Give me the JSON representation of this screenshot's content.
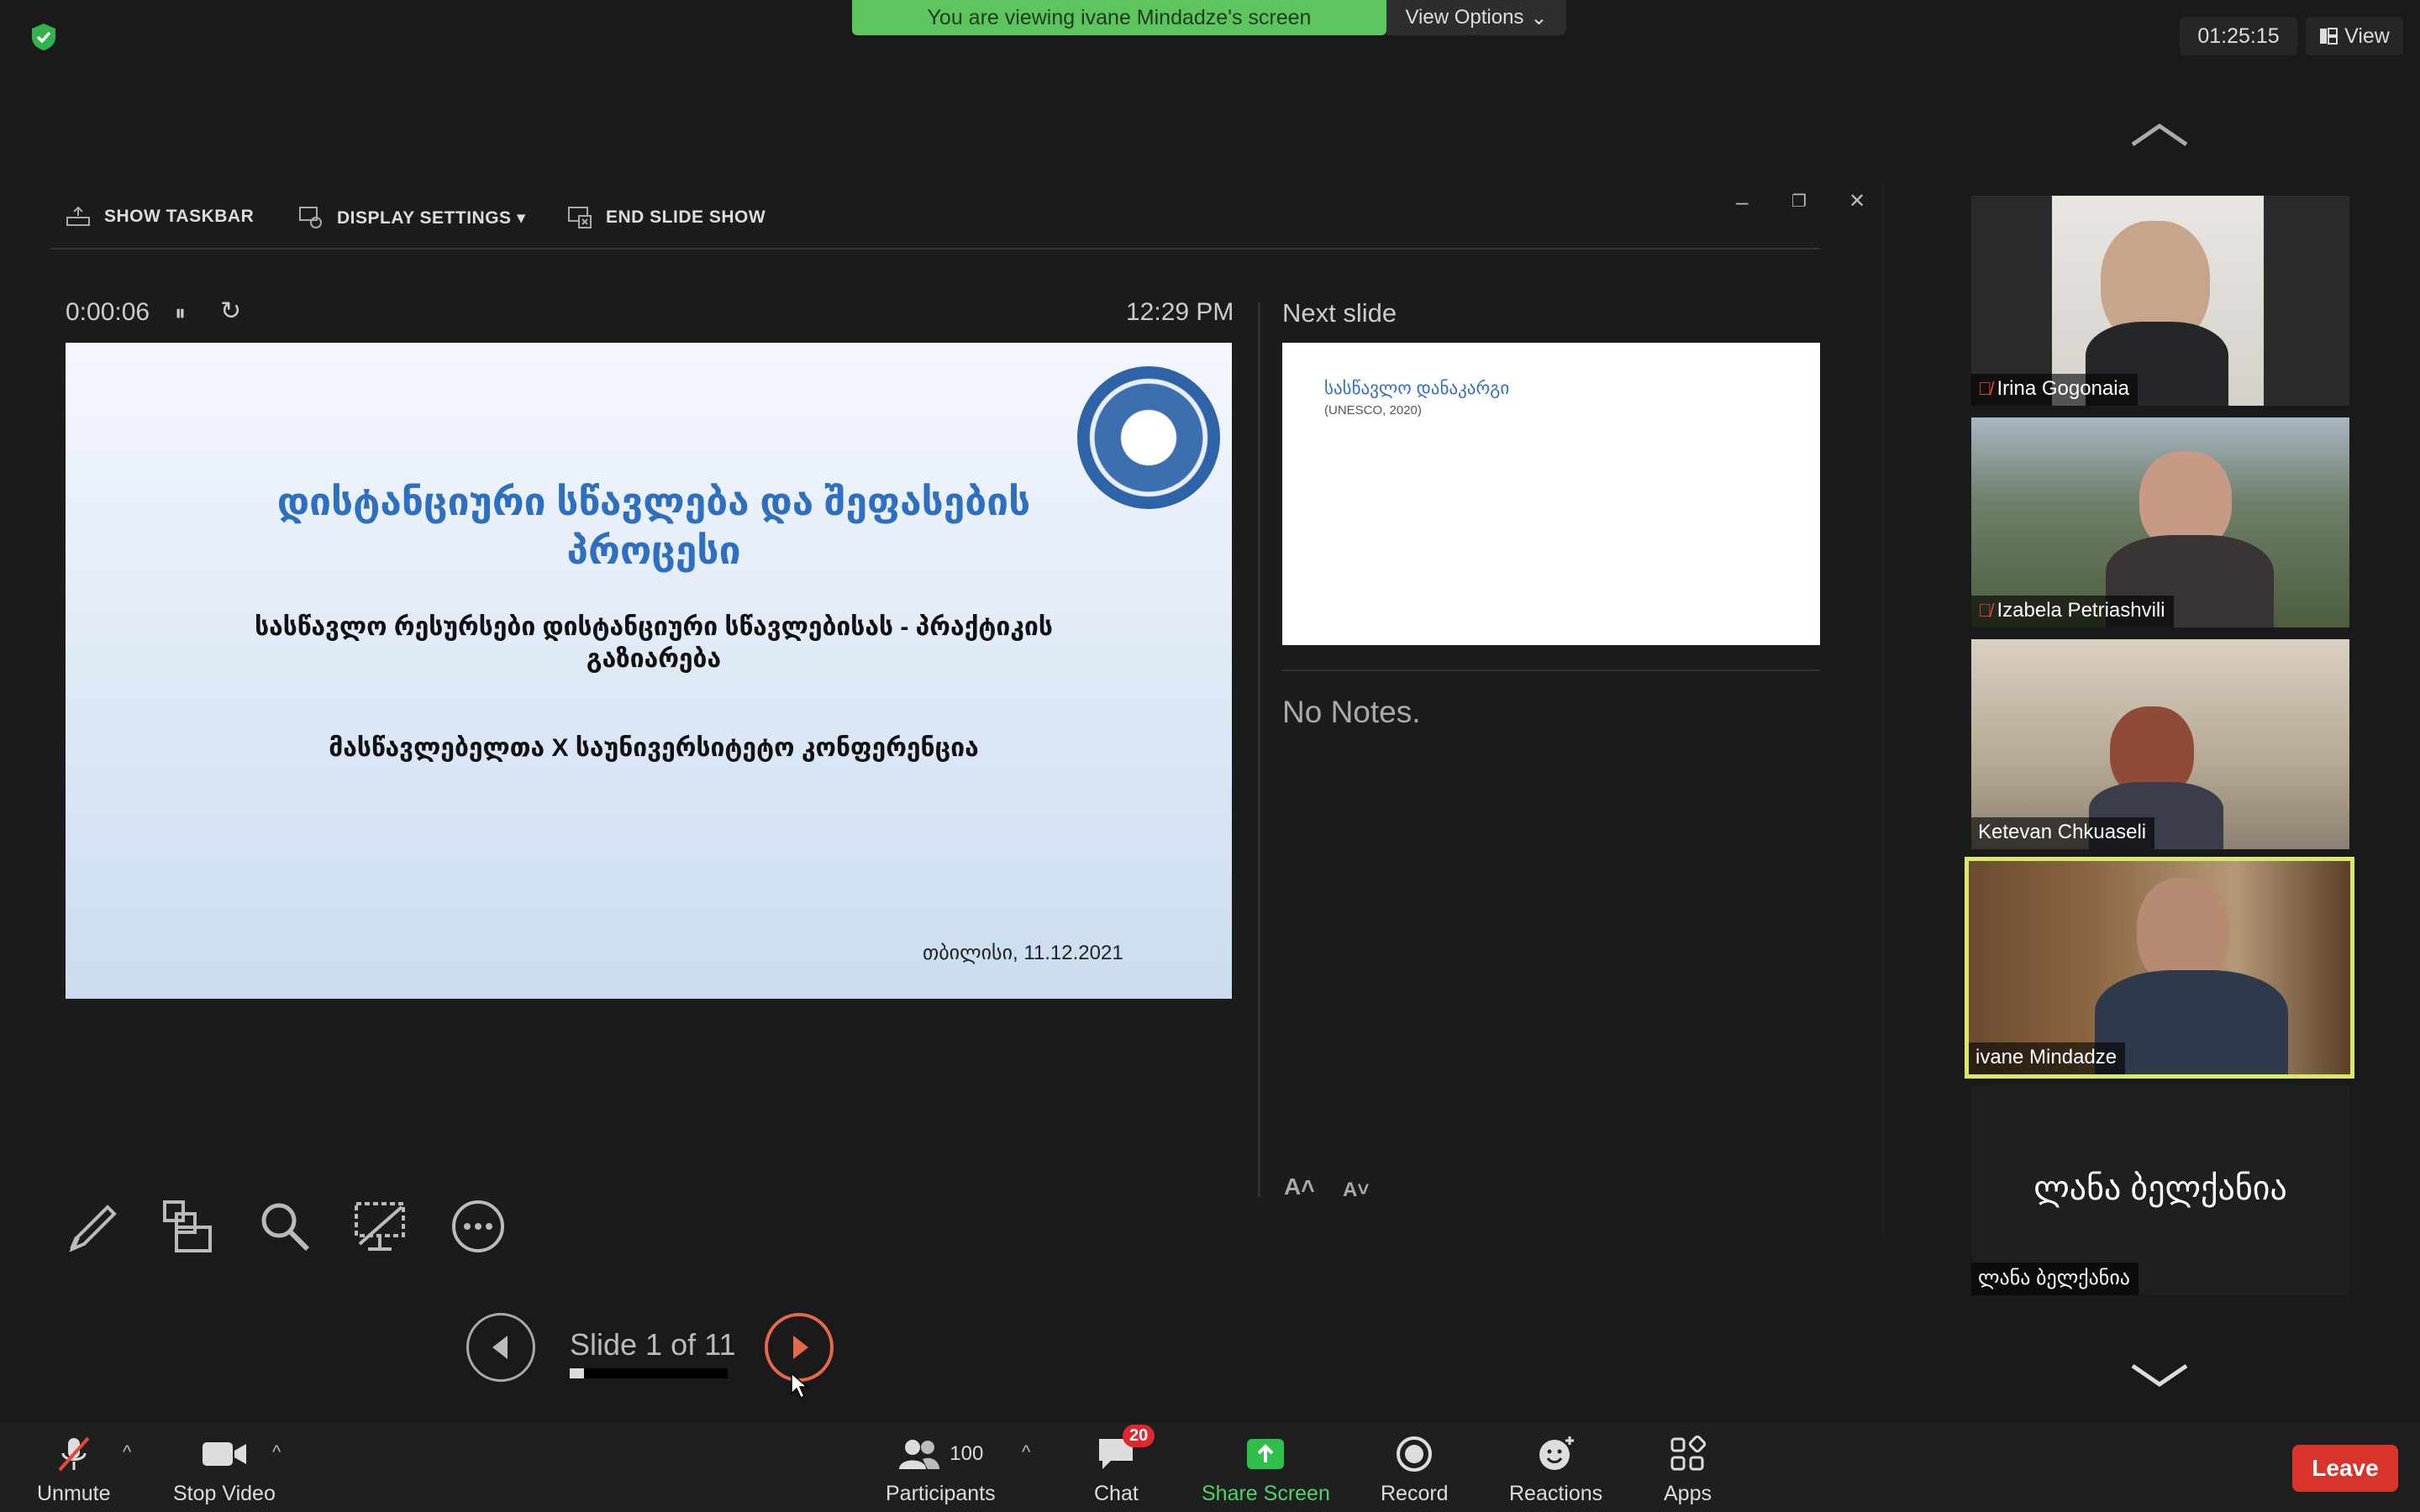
{
  "top": {
    "banner": "You are viewing ivane Mindadze's screen",
    "view_options": "View Options",
    "timer": "01:25:15",
    "view": "View"
  },
  "presenter": {
    "toolbar": {
      "show_taskbar": "SHOW TASKBAR",
      "display_settings": "DISPLAY SETTINGS ▾",
      "end_slide_show": "END SLIDE SHOW"
    },
    "elapsed": "0:00:06",
    "clock": "12:29 PM",
    "slide": {
      "title": "დისტანციური სწავლება და შეფასების პროცესი",
      "subtitle": "სასწავლო რესურსები დისტანციური სწავლებისას - პრაქტიკის გაზიარება",
      "conference": "მასწავლებელთა X საუნივერსიტეტო კონფერენცია",
      "date": "თბილისი, 11.12.2021"
    },
    "slide_counter": "Slide 1 of 11",
    "progress": 0.091,
    "next_slide_label": "Next slide",
    "next_thumb": {
      "title": "სასწავლო დანაკარგი",
      "subtitle": "(UNESCO, 2020)"
    },
    "notes": "No Notes."
  },
  "gallery": [
    {
      "name": "Irina Gogonaia",
      "muted": true
    },
    {
      "name": "Izabela Petriashvili",
      "muted": true
    },
    {
      "name": "Ketevan Chkuaseli",
      "muted": false
    },
    {
      "name": "ivane Mindadze",
      "muted": false,
      "active_speaker": true
    },
    {
      "name": "ლანა ბელქანია",
      "muted": false,
      "video_off": true
    }
  ],
  "bottom": {
    "unmute": "Unmute",
    "stop_video": "Stop Video",
    "participants_count": "100",
    "participants": "Participants",
    "chat_badge": "20",
    "chat": "Chat",
    "share_screen": "Share Screen",
    "record": "Record",
    "reactions": "Reactions",
    "apps": "Apps",
    "leave": "Leave"
  },
  "colors": {
    "banner": "#5ec45e",
    "leave": "#d8342c",
    "active_speaker_border": "#d9e86c",
    "slide_title": "#2f6fbf",
    "next_button": "#e4694a"
  }
}
